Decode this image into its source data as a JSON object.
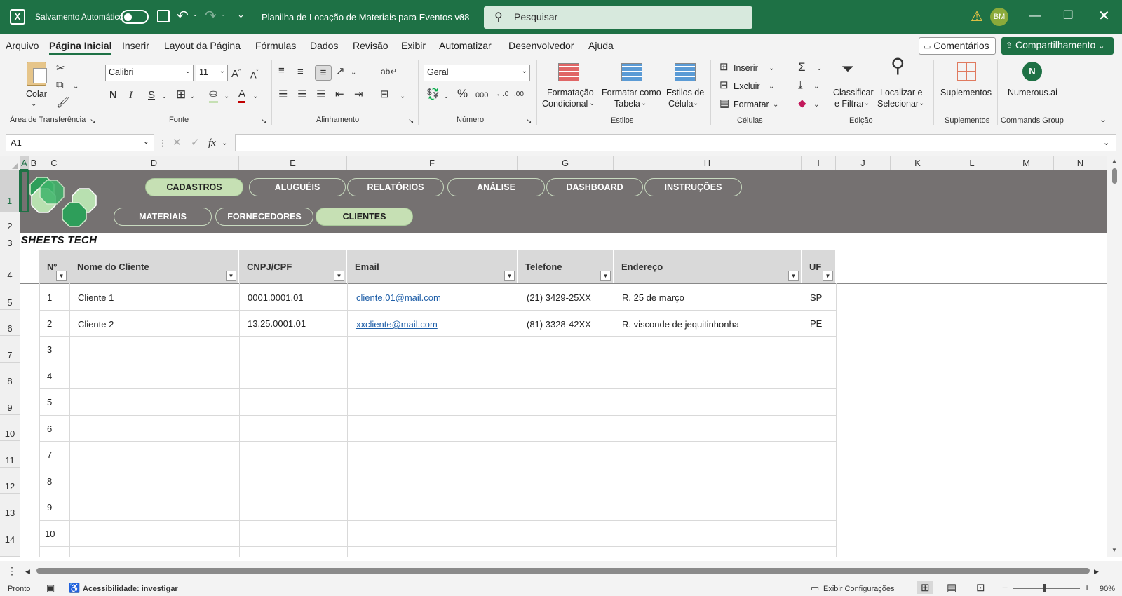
{
  "titlebar": {
    "autosave_label": "Salvamento Automático",
    "autosave_state": "off",
    "doc_title": "Planilha de Locação de Materiais para Eventos v08",
    "search_placeholder": "Pesquisar",
    "user_initials": "BM"
  },
  "menu": {
    "items": [
      "Arquivo",
      "Página Inicial",
      "Inserir",
      "Layout da Página",
      "Fórmulas",
      "Dados",
      "Revisão",
      "Exibir",
      "Automatizar",
      "Desenvolvedor",
      "Ajuda"
    ],
    "active": "Página Inicial",
    "comments_label": "Comentários",
    "share_label": "Compartilhamento"
  },
  "ribbon": {
    "clipboard": {
      "paste_label": "Colar",
      "group_label": "Área de Transferência"
    },
    "font": {
      "font_name": "Calibri",
      "font_size": "11",
      "bold": "N",
      "italic": "I",
      "underline": "S",
      "group_label": "Fonte"
    },
    "alignment": {
      "group_label": "Alinhamento"
    },
    "number": {
      "format": "Geral",
      "percent": "%",
      "thousands": "000",
      "group_label": "Número"
    },
    "styles": {
      "conditional_line1": "Formatação",
      "conditional_line2": "Condicional",
      "table_line1": "Formatar como",
      "table_line2": "Tabela",
      "cell_styles_line1": "Estilos de",
      "cell_styles_line2": "Célula",
      "group_label": "Estilos"
    },
    "cells": {
      "insert": "Inserir",
      "delete": "Excluir",
      "format": "Formatar",
      "group_label": "Células"
    },
    "editing": {
      "sort_line1": "Classificar",
      "sort_line2": "e Filtrar",
      "find_line1": "Localizar e",
      "find_line2": "Selecionar",
      "group_label": "Edição"
    },
    "addins": {
      "label": "Suplementos",
      "group_label": "Suplementos"
    },
    "commands": {
      "label": "Numerous.ai",
      "group_label": "Commands Group"
    }
  },
  "formula_bar": {
    "name_box": "A1",
    "fx": "fx",
    "formula": ""
  },
  "columns": [
    "A",
    "B",
    "C",
    "D",
    "E",
    "F",
    "G",
    "H",
    "I",
    "J",
    "K",
    "L",
    "M",
    "N"
  ],
  "rows": [
    "1",
    "2",
    "3",
    "4",
    "5",
    "6",
    "7",
    "8",
    "9",
    "10",
    "11",
    "12",
    "13",
    "14"
  ],
  "banner": {
    "nav_top": [
      "CADASTROS",
      "ALUGUÉIS",
      "RELATÓRIOS",
      "ANÁLISE",
      "DASHBOARD",
      "INSTRUÇÕES"
    ],
    "nav_bottom": [
      "MATERIAIS",
      "FORNECEDORES",
      "CLIENTES"
    ],
    "active_top": "CADASTROS",
    "active_bottom": "CLIENTES",
    "brand": "SHEETS TECH"
  },
  "table": {
    "headers": [
      "Nº",
      "Nome do Cliente",
      "CNPJ/CPF",
      "Email",
      "Telefone",
      "Endereço",
      "UF"
    ],
    "rows": [
      [
        "1",
        "Cliente 1",
        "0001.0001.01",
        "cliente.01@mail.com",
        "(21) 3429-25XX",
        "R. 25 de março",
        "SP"
      ],
      [
        "2",
        "Cliente 2",
        "13.25.0001.01",
        "xxcliente@mail.com",
        "(81) 3328-42XX",
        "R. visconde de jequitinhonha",
        "PE"
      ],
      [
        "3",
        "",
        "",
        "",
        "",
        "",
        ""
      ],
      [
        "4",
        "",
        "",
        "",
        "",
        "",
        ""
      ],
      [
        "5",
        "",
        "",
        "",
        "",
        "",
        ""
      ],
      [
        "6",
        "",
        "",
        "",
        "",
        "",
        ""
      ],
      [
        "7",
        "",
        "",
        "",
        "",
        "",
        ""
      ],
      [
        "8",
        "",
        "",
        "",
        "",
        "",
        ""
      ],
      [
        "9",
        "",
        "",
        "",
        "",
        "",
        ""
      ],
      [
        "10",
        "",
        "",
        "",
        "",
        "",
        ""
      ]
    ]
  },
  "statusbar": {
    "ready": "Pronto",
    "accessibility": "Acessibilidade: investigar",
    "display_settings": "Exibir Configurações",
    "zoom": "90%"
  },
  "colors": {
    "title_green": "#1e7145",
    "banner_gray": "#757171",
    "pill_active": "#c6e0b4",
    "header_gray": "#d9d9d9",
    "link": "#1f5fa8"
  }
}
